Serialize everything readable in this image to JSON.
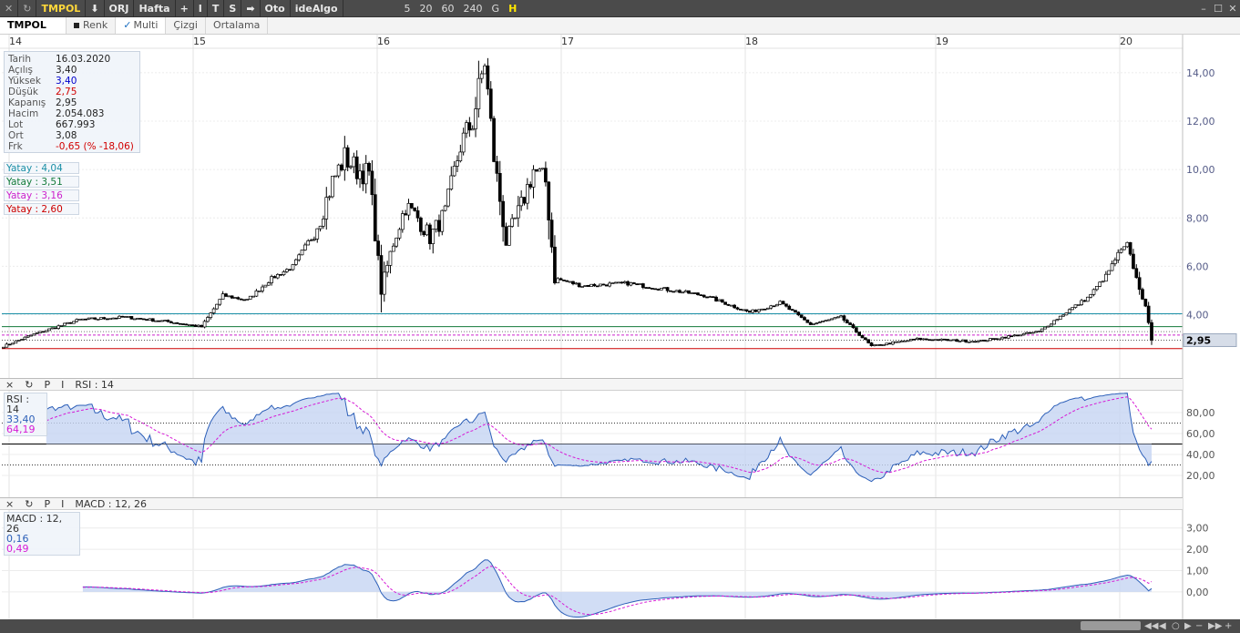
{
  "toolbar": {
    "symbol": "TMPOL",
    "items": [
      "ORJ",
      "Hafta",
      "+",
      "I",
      "T",
      "S",
      "➡",
      "Oto",
      "ideAlgo"
    ],
    "intervals": [
      "5",
      "20",
      "60",
      "240",
      "G",
      "H"
    ],
    "active_interval": "H"
  },
  "tabs": {
    "symbol": "TMPOL",
    "renk": "Renk",
    "multi": "Multi",
    "cizgi": "Çizgi",
    "ortalama": "Ortalama"
  },
  "info": [
    {
      "k": "Tarih",
      "v": "16.03.2020",
      "c": ""
    },
    {
      "k": "Açılış",
      "v": "3,40",
      "c": ""
    },
    {
      "k": "Yüksek",
      "v": "3,40",
      "c": "blue"
    },
    {
      "k": "Düşük",
      "v": "2,75",
      "c": "red"
    },
    {
      "k": "Kapanış",
      "v": "2,95",
      "c": ""
    },
    {
      "k": "Hacim",
      "v": "2.054.083",
      "c": ""
    },
    {
      "k": "Lot",
      "v": "667.993",
      "c": ""
    },
    {
      "k": "Ort",
      "v": "3,08",
      "c": ""
    },
    {
      "k": "Frk",
      "v": "-0,65 (% -18,06)",
      "c": "red"
    }
  ],
  "yatay": [
    {
      "label": "Yatay : 4,04",
      "value": 4.04,
      "color": "#1a8fa6"
    },
    {
      "label": "Yatay : 3,51",
      "value": 3.51,
      "color": "#127a3a"
    },
    {
      "label": "Yatay : 3,16",
      "value": 3.16,
      "color": "#cc22cc"
    },
    {
      "label": "Yatay : 2,60",
      "value": 2.6,
      "color": "#cc0000"
    }
  ],
  "last_price_label": "2,95",
  "rsi_panel": {
    "title": "RSI : 14",
    "legend_name": "RSI : 14",
    "v1": "33,40",
    "v2": "64,19",
    "color1": "#2c5fb8",
    "color2": "#d61ad6"
  },
  "macd_panel": {
    "title": "MACD : 12, 26",
    "legend_name": "MACD : 12, 26",
    "v1": "0,16",
    "v2": "0,49",
    "color1": "#2c5fb8",
    "color2": "#d61ad6"
  },
  "panel_buttons": [
    "×",
    "↻",
    "P",
    "I"
  ],
  "chart_data": [
    {
      "type": "candlestick",
      "x_axis_labels": [
        "14",
        "15",
        "16",
        "17",
        "18",
        "19",
        "20"
      ],
      "ylim": [
        1.5,
        15.5
      ],
      "y_ticks": [
        4,
        6,
        8,
        10,
        12,
        14
      ],
      "y_tick_labels": [
        "4,00",
        "6,00",
        "8,00",
        "10,00",
        "12,00",
        "14,00"
      ],
      "grid": true,
      "series": [
        {
          "name": "TMPOL",
          "key_points": [
            [
              0,
              2.7
            ],
            [
              10,
              3.2
            ],
            [
              25,
              3.8
            ],
            [
              40,
              3.9
            ],
            [
              55,
              3.7
            ],
            [
              65,
              3.5
            ],
            [
              72,
              4.8
            ],
            [
              80,
              4.6
            ],
            [
              88,
              5.5
            ],
            [
              95,
              6.0
            ],
            [
              100,
              7.0
            ],
            [
              104,
              8.0
            ],
            [
              108,
              9.5
            ],
            [
              112,
              10.5
            ],
            [
              116,
              10.0
            ],
            [
              120,
              9.8
            ],
            [
              124,
              5.0
            ],
            [
              128,
              7.0
            ],
            [
              132,
              8.5
            ],
            [
              136,
              8.0
            ],
            [
              140,
              7.2
            ],
            [
              145,
              8.2
            ],
            [
              150,
              11.0
            ],
            [
              154,
              12.0
            ],
            [
              158,
              14.5
            ],
            [
              161,
              10.5
            ],
            [
              165,
              7.0
            ],
            [
              170,
              8.5
            ],
            [
              174,
              10.0
            ],
            [
              178,
              9.5
            ],
            [
              181,
              5.5
            ],
            [
              190,
              5.2
            ],
            [
              205,
              5.3
            ],
            [
              230,
              4.8
            ],
            [
              245,
              4.1
            ],
            [
              255,
              4.5
            ],
            [
              265,
              3.6
            ],
            [
              275,
              3.9
            ],
            [
              285,
              2.7
            ],
            [
              300,
              3.0
            ],
            [
              320,
              2.9
            ],
            [
              340,
              3.3
            ],
            [
              350,
              4.2
            ],
            [
              356,
              4.7
            ],
            [
              362,
              5.6
            ],
            [
              366,
              6.5
            ],
            [
              369,
              6.9
            ],
            [
              372,
              5.5
            ],
            [
              375,
              4.3
            ],
            [
              377,
              2.95
            ]
          ]
        }
      ]
    },
    {
      "type": "line",
      "name": "RSI : 14",
      "ylim": [
        0,
        100
      ],
      "y_ticks": [
        20,
        40,
        60,
        80
      ],
      "y_tick_labels": [
        "20,00",
        "40,00",
        "60,00",
        "80,00"
      ],
      "levels": [
        30,
        70
      ],
      "series": [
        {
          "name": "RSI",
          "values_last": 33.4
        },
        {
          "name": "MA",
          "values_last": 64.19
        }
      ]
    },
    {
      "type": "line",
      "name": "MACD : 12, 26",
      "ylim": [
        -1.2,
        3.8
      ],
      "y_ticks": [
        0,
        1,
        2,
        3
      ],
      "y_tick_labels": [
        "0,00",
        "1,00",
        "2,00",
        "3,00"
      ],
      "series": [
        {
          "name": "MACD",
          "values_last": 0.16
        },
        {
          "name": "Signal",
          "values_last": 0.49
        }
      ]
    }
  ]
}
